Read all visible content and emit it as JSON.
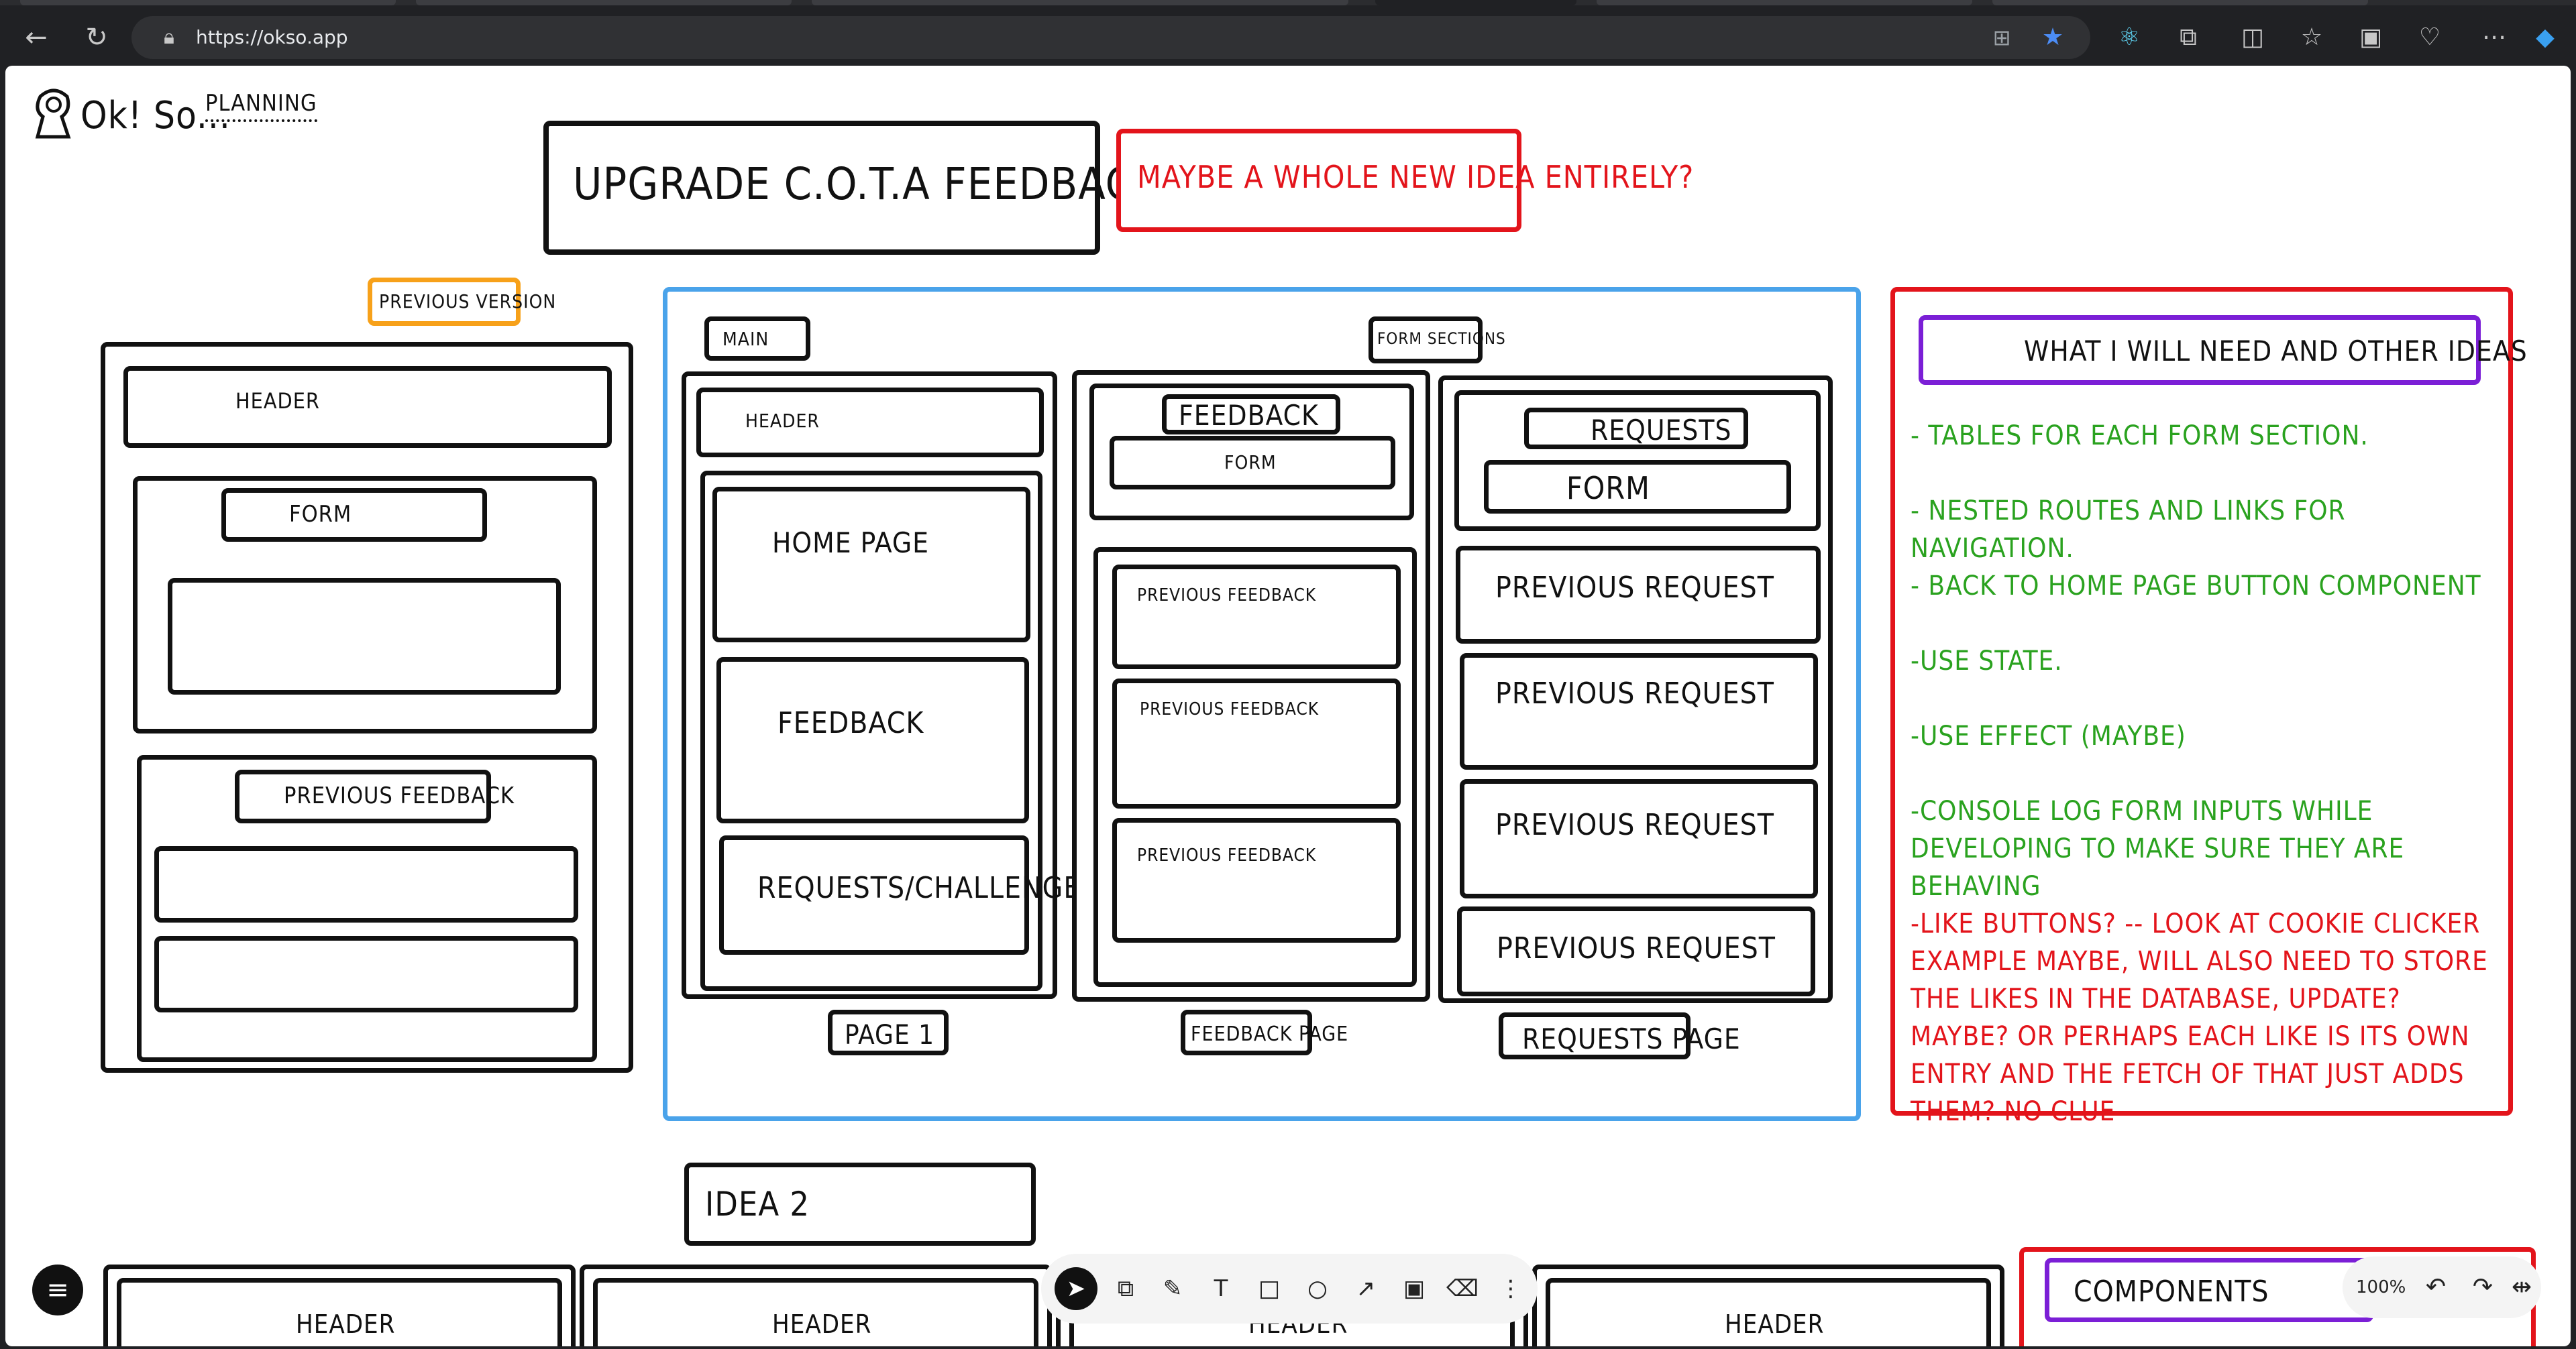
{
  "browser": {
    "url": "https://okso.app",
    "nav_icons": [
      "back-arrow-icon",
      "reload-icon"
    ],
    "toolbar_icons": [
      "tab-grid-icon",
      "star-icon",
      "react-icon",
      "extensions-icon",
      "split-screen-icon",
      "favorites-icon",
      "collections-icon",
      "performance-icon",
      "more-icon",
      "copilot-icon"
    ]
  },
  "app": {
    "logo_text": "Ok! So...",
    "nav_planning": "Planning"
  },
  "board": {
    "title": "Upgrade C.O.T.A feedback page?",
    "maybe_note": "Maybe a whole new idea entirely?",
    "previous_version": {
      "tag": "Previous version",
      "header": "Header",
      "form": "Form",
      "previous_feedback": "Previous feedback"
    },
    "new_design": {
      "main_tag": "Main",
      "form_sections_tag": "Form sections",
      "page1": {
        "header": "Header",
        "home": "Home page",
        "feedback": "Feedback",
        "requests": "Requests/Challenges",
        "caption": "Page 1"
      },
      "feedback_page": {
        "title": "Feedback",
        "form": "Form",
        "items": [
          "Previous feedback",
          "Previous feedback",
          "Previous feedback"
        ],
        "caption": "Feedback page"
      },
      "requests_page": {
        "title": "Requests",
        "form": "Form",
        "items": [
          "Previous request",
          "Previous request",
          "Previous request",
          "Previous request"
        ],
        "caption": "Requests page"
      }
    },
    "ideas_panel": {
      "title": "What I will need and other ideas",
      "green_notes": [
        "- Tables for each form section.",
        "- Nested routes and links for navigation.",
        "- Back to home page button component",
        "-Use state.",
        "-Use effect (maybe)",
        "-Console log form inputs while developing to make sure they are behaving"
      ],
      "red_note": "-Like buttons? -- look at cookie clicker example maybe, will also need to store the likes in the database, update? maybe? Or perhaps each like is its own entry and the fetch of that just adds them? no clue"
    },
    "idea2": {
      "label": "Idea 2",
      "headers": [
        "Header",
        "Header",
        "Header",
        "Header"
      ]
    },
    "components_label": "Components"
  },
  "toolbar": {
    "tools": [
      "pointer-icon",
      "copy-icon",
      "pen-icon",
      "text-icon",
      "rectangle-icon",
      "ellipse-icon",
      "arrow-icon",
      "image-icon",
      "eraser-icon",
      "more-vertical-icon"
    ],
    "glyphs": [
      "➤",
      "⧉",
      "✎",
      "T",
      "□",
      "○",
      "↗",
      "▣",
      "⌫",
      "⋮"
    ]
  },
  "zoom": {
    "level": "100%"
  },
  "colors": {
    "red": "#e3141b",
    "blue": "#4aa3ea",
    "orange": "#f7a11a",
    "purple": "#7b1fd6",
    "green": "#2aa21f"
  }
}
